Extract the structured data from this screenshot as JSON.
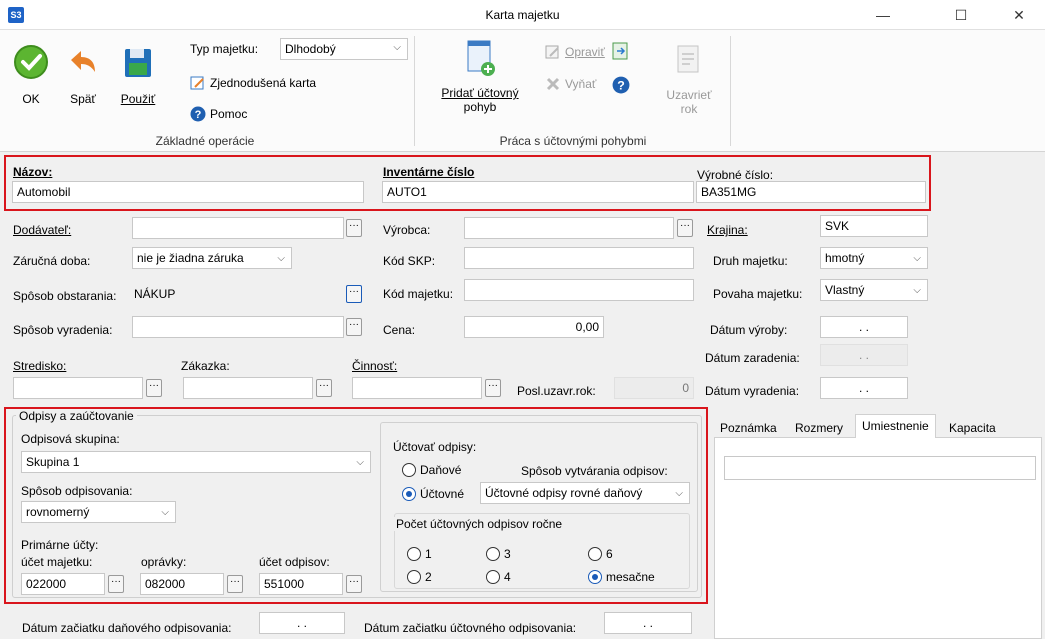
{
  "window": {
    "app_icon": "S3",
    "title": "Karta majetku",
    "minimize": "—",
    "maximize": "☐",
    "close": "✕"
  },
  "ribbon": {
    "ok": "OK",
    "back": "Späť",
    "apply": "Použiť",
    "asset_type_label": "Typ majetku:",
    "asset_type_value": "Dlhodobý",
    "simplified_card": "Zjednodušená karta",
    "help": "Pomoc",
    "group_basic": "Základné operácie",
    "add_movement_1": "Pridať účtovný",
    "add_movement_2": "pohyb",
    "edit": "Opraviť",
    "remove": "Vyňať",
    "close_year_1": "Uzavrieť",
    "close_year_2": "rok",
    "group_movements": "Práca s účtovnými pohybmi"
  },
  "header": {
    "name_label": "Názov:",
    "name_value": "Automobil",
    "inventory_label": "Inventárne číslo",
    "inventory_value": "AUTO1",
    "serial_label": "Výrobné číslo:",
    "serial_value": "BA351MG"
  },
  "fields": {
    "supplier_label": "Dodávateľ:",
    "supplier_value": "",
    "manufacturer_label": "Výrobca:",
    "manufacturer_value": "",
    "country_label": "Krajina:",
    "country_value": "SVK",
    "warranty_label": "Záručná doba:",
    "warranty_value": "nie je žiadna záruka",
    "skp_label": "Kód SKP:",
    "skp_value": "",
    "asset_kind_label": "Druh majetku:",
    "asset_kind_value": "hmotný",
    "acquisition_label": "Spôsob obstarania:",
    "acquisition_value": "NÁKUP",
    "asset_code_label": "Kód majetku:",
    "asset_code_value": "",
    "asset_nature_label": "Povaha majetku:",
    "asset_nature_value": "Vlastný",
    "disposal_label": "Spôsob vyradenia:",
    "disposal_value": "",
    "price_label": "Cena:",
    "price_value": "0,00",
    "production_date_label": "Dátum výroby:",
    "production_date_value": ". .",
    "inclusion_date_label": "Dátum zaradenia:",
    "inclusion_date_value": ". .",
    "center_label": "Stredisko:",
    "order_label": "Zákazka:",
    "activity_label": "Činnosť:",
    "last_closed_label": "Posl.uzavr.rok:",
    "last_closed_value": "0",
    "disposal_date_label": "Dátum vyradenia:",
    "disposal_date_value": ". ."
  },
  "depreciation": {
    "legend": "Odpisy a zaúčtovanie",
    "group_label": "Odpisová skupina:",
    "group_value": "Skupina 1",
    "method_label": "Spôsob odpisovania:",
    "method_value": "rovnomerný",
    "primary_accounts": "Primárne účty:",
    "asset_account_label": "účet majetku:",
    "asset_account_value": "022000",
    "adjustments_label": "oprávky:",
    "adjustments_value": "082000",
    "depr_account_label": "účet odpisov:",
    "depr_account_value": "551000",
    "post_label": "Účtovať odpisy:",
    "tax_option": "Daňové",
    "accounting_option": "Účtovné",
    "creation_label": "Spôsob vytvárania odpisov:",
    "creation_value": "Účtovné odpisy rovné daňový",
    "yearly_count_label": "Počet účtovných odpisov ročne",
    "count_options": [
      "1",
      "3",
      "6",
      "2",
      "4",
      "mesačne"
    ]
  },
  "tabs": [
    "Poznámka",
    "Rozmery",
    "Umiestnenie",
    "Kapacita"
  ],
  "bottom": {
    "tax_start_label": "Dátum začiatku daňového odpisovania:",
    "tax_start_value": ". .",
    "acc_start_label": "Dátum začiatku účtovného odpisovania:",
    "acc_start_value": ". ."
  },
  "colors": {
    "accent": "#1a5bb8",
    "highlight_border": "#d9151c",
    "ok_green": "#5cb531",
    "back_orange": "#e8812a"
  }
}
